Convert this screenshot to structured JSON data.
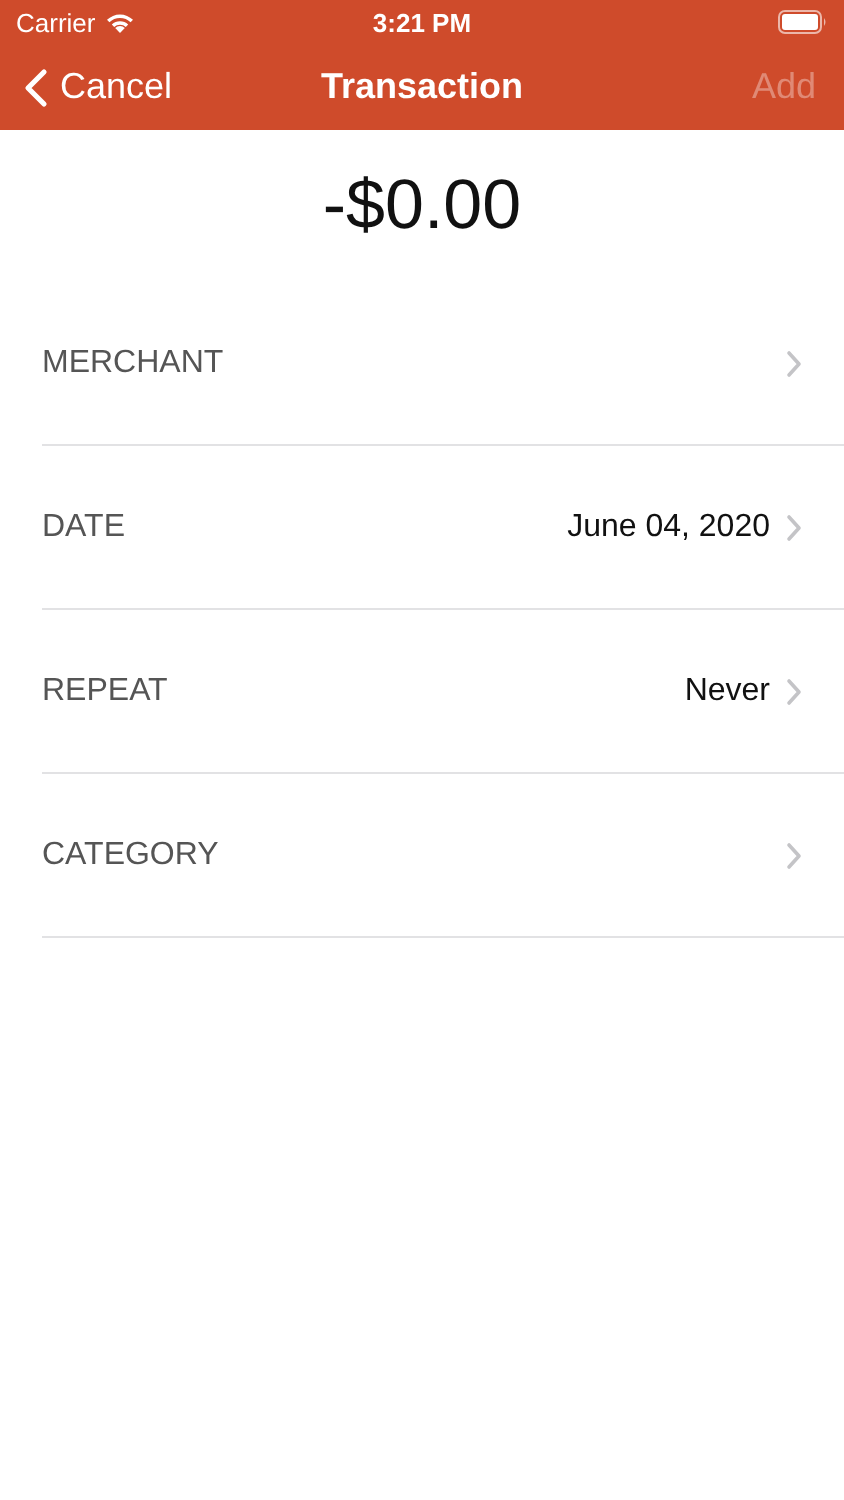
{
  "status_bar": {
    "carrier": "Carrier",
    "time": "3:21 PM"
  },
  "nav_bar": {
    "back": "Cancel",
    "title": "Transaction",
    "action": {
      "label": "Add",
      "disabled": true
    }
  },
  "amount": "-$0.00",
  "fields": [
    {
      "label": "MERCHANT"
    },
    {
      "label": "DATE",
      "value": "June 04, 2020"
    },
    {
      "label": "REPEAT",
      "value": "Never"
    },
    {
      "label": "CATEGORY"
    }
  ]
}
